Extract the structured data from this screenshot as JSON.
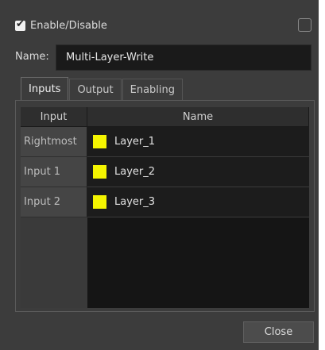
{
  "header": {
    "enable_checked": true,
    "enable_label": "Enable/Disable",
    "check_mark": "✔"
  },
  "name": {
    "label": "Name:",
    "value": "Multi-Layer-Write"
  },
  "tabs": [
    {
      "label": "Inputs",
      "active": true
    },
    {
      "label": "Output",
      "active": false
    },
    {
      "label": "Enabling",
      "active": false
    }
  ],
  "table": {
    "headers": {
      "input": "Input",
      "name": "Name"
    },
    "rows": [
      {
        "input": "Rightmost",
        "name": "Layer_1",
        "color": "#f5f500"
      },
      {
        "input": "Input 1",
        "name": "Layer_2",
        "color": "#f5f500"
      },
      {
        "input": "Input 2",
        "name": "Layer_3",
        "color": "#f5f500"
      }
    ]
  },
  "footer": {
    "close_label": "Close"
  }
}
